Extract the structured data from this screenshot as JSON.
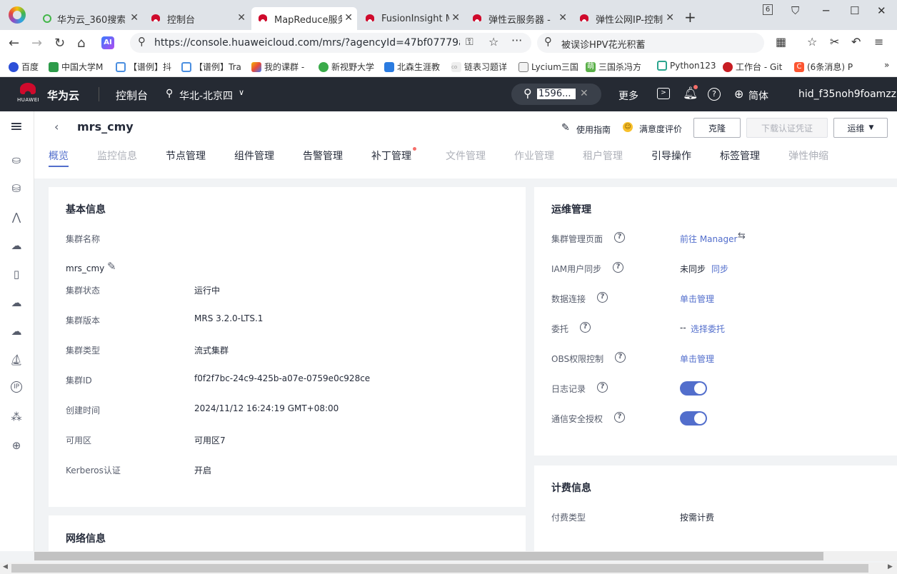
{
  "browser": {
    "tabs": [
      {
        "title": "华为云_360搜索",
        "active": false
      },
      {
        "title": "控制台",
        "active": false
      },
      {
        "title": "MapReduce服务",
        "active": true
      },
      {
        "title": "FusionInsight M",
        "active": false
      },
      {
        "title": "弹性云服务器 - ",
        "active": false
      },
      {
        "title": "弹性公网IP-控制",
        "active": false
      }
    ],
    "tab_count": "6",
    "url": "https://console.huaweicloud.com/mrs/?agencyId=47bf07779a76",
    "search_text": "被误诊HPV花光积蓄",
    "bookmarks": [
      "百度",
      "中国大学M",
      "【谱例】抖",
      "【谱例】Tra",
      "我的课群 -",
      "新视野大学",
      "北森生涯教",
      "链表习题详",
      "Lycium三国",
      "三国杀冯方",
      "Python123",
      "工作台 - Git",
      "(6条消息) P"
    ]
  },
  "console": {
    "brand_logo_text": "HUAWEI",
    "brand": "华为云",
    "console_label": "控制台",
    "region": "华北-北京四",
    "search_value": "1596...",
    "more": "更多",
    "lang": "简体",
    "user": "hid_f35noh9foamzzph"
  },
  "page": {
    "title": "mrs_cmy",
    "guide": "使用指南",
    "rating": "满意度评价",
    "clone": "克隆",
    "download_cert": "下载认证凭证",
    "ops": "运维",
    "tabs": [
      "概览",
      "监控信息",
      "节点管理",
      "组件管理",
      "告警管理",
      "补丁管理",
      "文件管理",
      "作业管理",
      "租户管理",
      "引导操作",
      "标签管理",
      "弹性伸缩"
    ]
  },
  "basic": {
    "title": "基本信息",
    "name_label": "集群名称",
    "name_value": "mrs_cmy",
    "rows": [
      {
        "label": "集群状态",
        "value": "运行中"
      },
      {
        "label": "集群版本",
        "value": "MRS 3.2.0-LTS.1"
      },
      {
        "label": "集群类型",
        "value": "流式集群"
      },
      {
        "label": "集群ID",
        "value": "f0f2f7bc-24c9-425b-a07e-0759e0c928ce"
      },
      {
        "label": "创建时间",
        "value": "2024/11/12 16:24:19 GMT+08:00"
      },
      {
        "label": "可用区",
        "value": "可用区7"
      },
      {
        "label": "Kerberos认证",
        "value": "开启"
      }
    ]
  },
  "network": {
    "title": "网络信息"
  },
  "ops": {
    "title": "运维管理",
    "rows": [
      {
        "label": "集群管理页面",
        "value": "前往 Manager"
      },
      {
        "label": "IAM用户同步",
        "value": "未同步",
        "link": "同步"
      },
      {
        "label": "数据连接",
        "value": "单击管理"
      },
      {
        "label": "委托",
        "value": "--",
        "link": "选择委托"
      },
      {
        "label": "OBS权限控制",
        "value": "单击管理"
      },
      {
        "label": "日志记录"
      },
      {
        "label": "通信安全授权"
      }
    ]
  },
  "billing": {
    "title": "计费信息",
    "type_label": "付费类型",
    "type_value": "按需计费"
  },
  "colors": {
    "accent": "#526ecc",
    "header_bg": "#252a33",
    "brand_red": "#cf0a2c"
  }
}
